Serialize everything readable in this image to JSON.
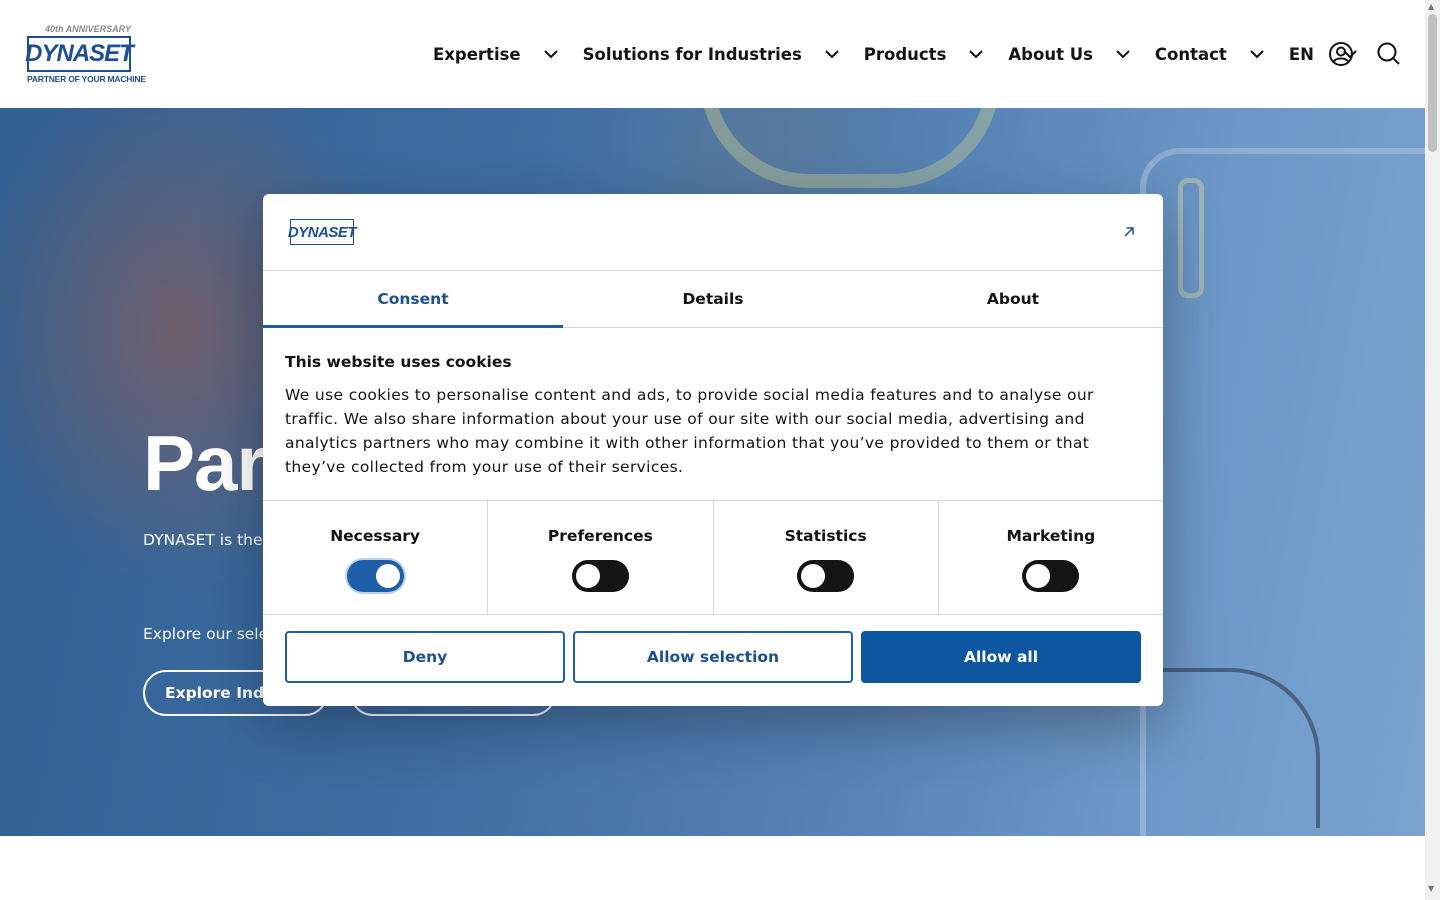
{
  "brand": {
    "anniversary": "40th ANNIVERSARY",
    "name": "DYNASET",
    "tagline": "PARTNER OF YOUR MACHINE"
  },
  "nav": {
    "items": [
      {
        "label": "Expertise"
      },
      {
        "label": "Solutions for Industries"
      },
      {
        "label": "Products"
      },
      {
        "label": "About Us"
      },
      {
        "label": "Contact"
      },
      {
        "label": "EN"
      }
    ]
  },
  "hero": {
    "title": "Part",
    "text": "DYNASET is the m extensive range mobile machine",
    "explore": "Explore our sele",
    "button1": "Explore Indu",
    "button2": ""
  },
  "dialog": {
    "logo": "DYNASET",
    "tabs": [
      "Consent",
      "Details",
      "About"
    ],
    "heading": "This website uses cookies",
    "body": "We use cookies to personalise content and ads, to provide social media features and to analyse our traffic. We also share information about your use of our site with our social media, advertising and analytics partners who may combine it with other information that you’ve provided to them or that they’ve collected from your use of their services.",
    "categories": [
      {
        "label": "Necessary",
        "enabled": true
      },
      {
        "label": "Preferences",
        "enabled": false
      },
      {
        "label": "Statistics",
        "enabled": false
      },
      {
        "label": "Marketing",
        "enabled": false
      }
    ],
    "buttons": {
      "deny": "Deny",
      "allow_selection": "Allow selection",
      "allow_all": "Allow all"
    }
  },
  "colors": {
    "brand_blue": "#1d4f91",
    "primary_button": "#0e56a0",
    "toggle_on": "#1d5fa7",
    "toggle_off": "#141414"
  }
}
